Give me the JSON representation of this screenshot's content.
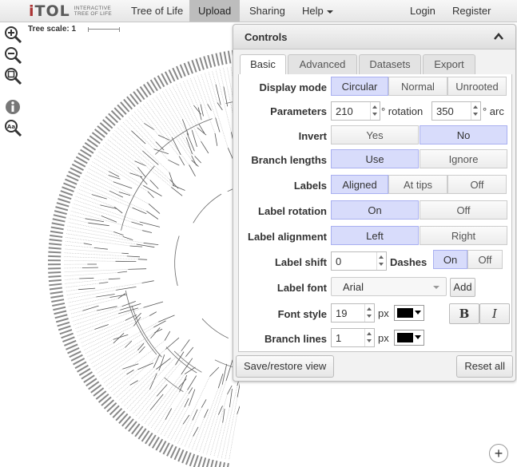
{
  "nav": {
    "logo_main": "iTOL",
    "logo_sub_line1": "INTERACTIVE",
    "logo_sub_line2": "TREE OF LIFE",
    "items": [
      "Tree of Life",
      "Upload",
      "Sharing",
      "Help",
      "Login",
      "Register"
    ],
    "active": "Upload"
  },
  "tree": {
    "scale_label": "Tree scale: 1",
    "tools": [
      "zoom-in-icon",
      "zoom-out-icon",
      "zoom-fit-icon",
      "info-icon",
      "font-zoom-icon"
    ]
  },
  "controls": {
    "title": "Controls",
    "tabs": [
      "Basic",
      "Advanced",
      "Datasets",
      "Export"
    ],
    "active_tab": "Basic",
    "display_mode": {
      "label": "Display mode",
      "options": [
        "Circular",
        "Normal",
        "Unrooted"
      ],
      "selected": "Circular"
    },
    "parameters": {
      "label": "Parameters",
      "value1": "210",
      "unit1": "° rotation",
      "value2": "350",
      "unit2": "° arc"
    },
    "invert": {
      "label": "Invert",
      "options": [
        "Yes",
        "No"
      ],
      "selected": "No"
    },
    "branch_lengths": {
      "label": "Branch lengths",
      "options": [
        "Use",
        "Ignore"
      ],
      "selected": "Use"
    },
    "labels": {
      "label": "Labels",
      "options": [
        "Aligned",
        "At tips",
        "Off"
      ],
      "selected": "Aligned"
    },
    "label_rotation": {
      "label": "Label rotation",
      "options": [
        "On",
        "Off"
      ],
      "selected": "On"
    },
    "label_alignment": {
      "label": "Label alignment",
      "options": [
        "Left",
        "Right"
      ],
      "selected": "Left"
    },
    "label_shift": {
      "label": "Label shift",
      "value": "0",
      "dashes_label": "Dashes",
      "dashes_options": [
        "On",
        "Off"
      ],
      "dashes_selected": "On"
    },
    "label_font": {
      "label": "Label font",
      "value": "Arial",
      "add_label": "Add"
    },
    "font_style": {
      "label": "Font style",
      "value": "19",
      "unit": "px",
      "color": "#000000",
      "bold": "B",
      "italic": "I"
    },
    "branch_lines": {
      "label": "Branch lines",
      "value": "1",
      "unit": "px",
      "color": "#000000"
    },
    "save_restore": "Save/restore view",
    "reset": "Reset all"
  },
  "zoom_button": "+",
  "colors": {
    "selected_bg": "#d8dcfb",
    "selected_border": "#a9b0f0",
    "active_nav": "#bdbdbd"
  }
}
